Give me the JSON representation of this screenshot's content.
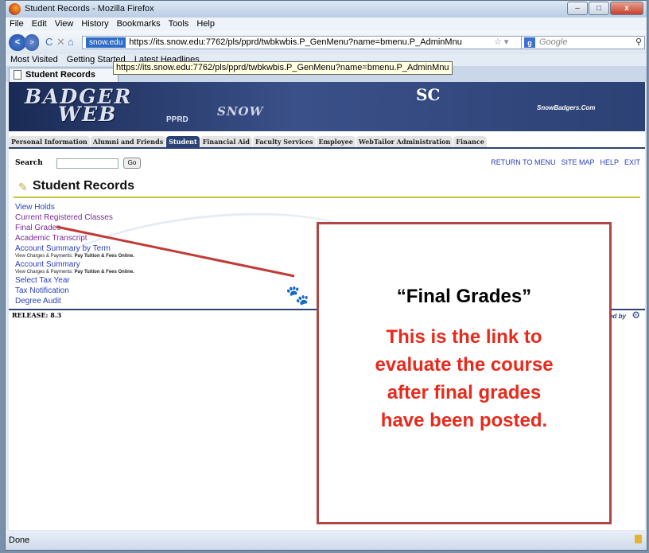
{
  "window": {
    "title": "Student Records - Mozilla Firefox",
    "controls": [
      "–",
      "□",
      "x"
    ]
  },
  "menubar": [
    "File",
    "Edit",
    "View",
    "History",
    "Bookmarks",
    "Tools",
    "Help"
  ],
  "navbar": {
    "back": "<",
    "forward": ">",
    "reload": "C",
    "stop": "✕",
    "home": "⌂",
    "site_badge": "snow.edu",
    "url": "https://its.snow.edu:7762/pls/pprd/twbkwbis.P_GenMenu?name=bmenu.P_AdminMnu",
    "search_placeholder": "Google",
    "search_engine": "g"
  },
  "bookmarks": [
    "Most Visited",
    "Getting Started",
    "Latest Headlines"
  ],
  "tooltip": "https://its.snow.edu:7762/pls/pprd/twbkwbis.P_GenMenu?name=bmenu.P_AdminMnu",
  "tab": {
    "label": "Student Records"
  },
  "banner": {
    "badger": "BADGER",
    "web": "WEB",
    "pprd": "PPRD",
    "snow": "SNOW",
    "sc": "SC",
    "site": "SnowBadgers.Com"
  },
  "top_tabs": [
    {
      "label": "Personal Information",
      "active": false
    },
    {
      "label": "Alumni and Friends",
      "active": false
    },
    {
      "label": "Student",
      "active": true
    },
    {
      "label": "Financial Aid",
      "active": false
    },
    {
      "label": "Faculty Services",
      "active": false
    },
    {
      "label": "Employee",
      "active": false
    },
    {
      "label": "WebTailor Administration",
      "active": false
    },
    {
      "label": "Finance",
      "active": false
    }
  ],
  "search": {
    "label": "Search",
    "button": "Go"
  },
  "top_links": [
    "RETURN TO MENU",
    "SITE MAP",
    "HELP",
    "EXIT"
  ],
  "page_title": "Student Records",
  "menu_items": [
    {
      "label": "View Holds",
      "visited": false,
      "sub": null
    },
    {
      "label": "Current Registered Classes",
      "visited": true,
      "sub": null
    },
    {
      "label": "Final Grades",
      "visited": true,
      "sub": null
    },
    {
      "label": "Academic Transcript",
      "visited": true,
      "sub": null
    },
    {
      "label": "Account Summary by Term",
      "visited": false,
      "sub": {
        "prefix": "View Charges & Payments:",
        "bold": "Pay Tuition & Fees Online."
      }
    },
    {
      "label": "Account Summary",
      "visited": false,
      "sub": {
        "prefix": "View Charges & Payments:",
        "bold": "Pay Tuition & Fees Online."
      }
    },
    {
      "label": "Select Tax Year",
      "visited": false,
      "sub": null
    },
    {
      "label": "Tax Notification",
      "visited": false,
      "sub": null
    },
    {
      "label": "Degree Audit",
      "visited": false,
      "sub": null
    }
  ],
  "release": "RELEASE: 8.3",
  "powered": "powered by",
  "status": "Done",
  "callout": {
    "title": "“Final Grades”",
    "body_lines": [
      "This is the link to",
      "evaluate the course",
      "after final grades",
      "have been posted."
    ]
  },
  "colors": {
    "callout_border": "#b24644",
    "callout_text": "#e82a1c",
    "arrow": "#c23a36",
    "link": "#2a3fb8",
    "visited": "#7b2a99",
    "banner": "#2c4275"
  }
}
